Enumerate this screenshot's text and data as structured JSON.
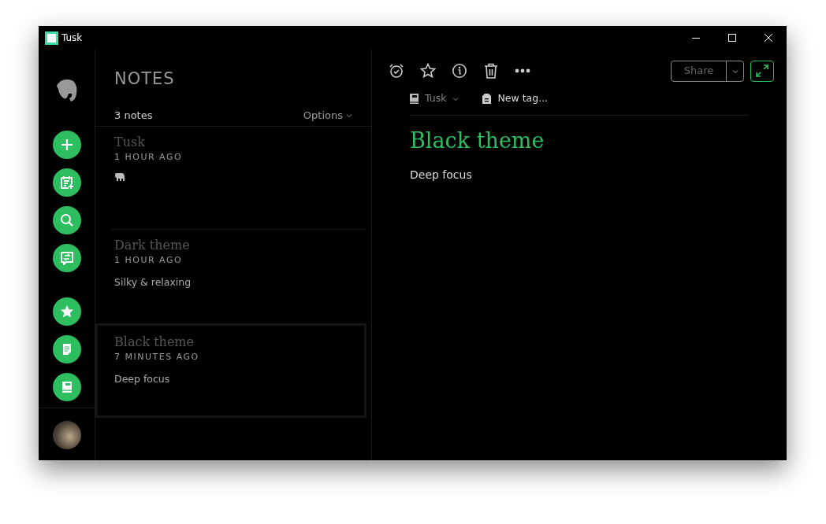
{
  "window": {
    "title": "Tusk"
  },
  "notes_list": {
    "heading": "NOTES",
    "count": "3 notes",
    "options": "Options",
    "notes": [
      {
        "title": "Tusk",
        "time": "1 HOUR AGO",
        "kind": "icon",
        "selected": false
      },
      {
        "title": "Dark theme",
        "time": "1 HOUR AGO",
        "kind": "text",
        "snippet": "Silky & relaxing",
        "selected": false
      },
      {
        "title": "Black theme",
        "time": "7 MINUTES AGO",
        "kind": "text",
        "snippet": "Deep focus",
        "selected": true
      }
    ]
  },
  "editor": {
    "share": "Share",
    "notebook": "Tusk",
    "tag_placeholder": "New tag...",
    "title": "Black theme",
    "body": "Deep focus"
  }
}
